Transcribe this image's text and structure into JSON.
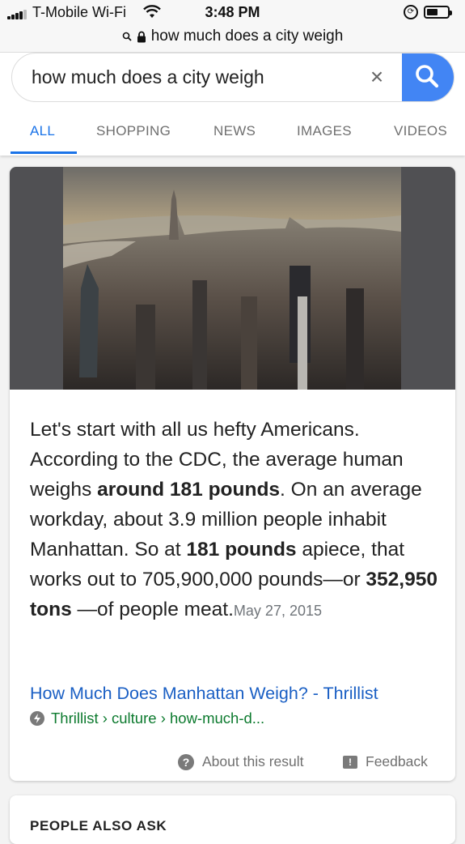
{
  "status_bar": {
    "carrier": "T-Mobile Wi-Fi",
    "time": "3:48 PM",
    "battery_level": 0.55
  },
  "url_bar": {
    "text": "how much does a city weigh"
  },
  "search": {
    "query": "how much does a city weigh",
    "clear_symbol": "×",
    "icon": "search-icon",
    "accent": "#4285f4"
  },
  "tabs": [
    {
      "label": "ALL",
      "active": true
    },
    {
      "label": "SHOPPING",
      "active": false
    },
    {
      "label": "NEWS",
      "active": false
    },
    {
      "label": "IMAGES",
      "active": false
    },
    {
      "label": "VIDEOS",
      "active": false
    }
  ],
  "featured": {
    "snippet": {
      "t1": "Let's start with all us hefty Americans. According to the CDC, the average human weighs ",
      "b1": "around 181 pounds",
      "t2": ". On an average workday, about 3.9 million people inhabit Manhattan. So at ",
      "b2": "181 pounds",
      "t3": " apiece, that works out to 705,900,000 pounds—or ",
      "b3": "352,950 tons",
      "t4": " —of people meat.",
      "date": "May 27, 2015"
    },
    "link_title": "How Much Does Manhattan Weigh? - Thrillist",
    "breadcrumb": "Thrillist › culture › how-much-d...",
    "about_label": "About this result",
    "feedback_label": "Feedback"
  },
  "people_also_ask": {
    "title": "PEOPLE ALSO ASK"
  },
  "colors": {
    "link": "#1a5fc4",
    "breadcrumb": "#0c7a2e",
    "active_tab": "#1a73e8"
  }
}
